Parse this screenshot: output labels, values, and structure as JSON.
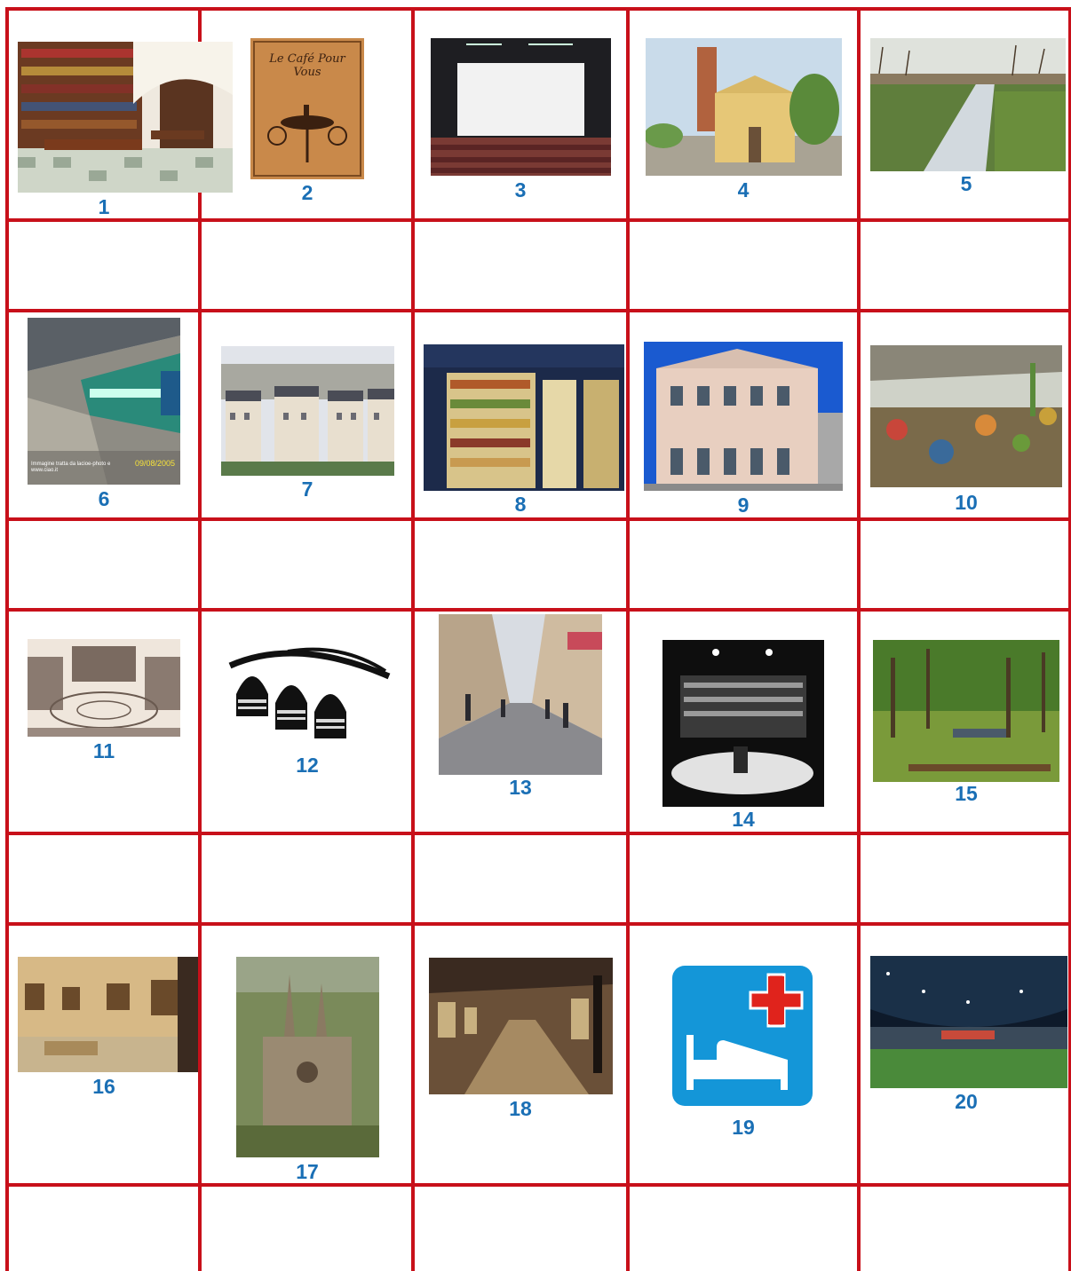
{
  "colors": {
    "grid_line": "#c8101a",
    "number_text": "#1a6fb5",
    "background": "#ffffff"
  },
  "items": [
    {
      "number": "1",
      "picture": "library-reading-room"
    },
    {
      "number": "2",
      "picture": "cafe-poster",
      "poster_text": "Le Café Pour Vous"
    },
    {
      "number": "3",
      "picture": "cinema-screen-room"
    },
    {
      "number": "4",
      "picture": "church-with-bell-tower"
    },
    {
      "number": "5",
      "picture": "canal-in-countryside"
    },
    {
      "number": "6",
      "picture": "train-station-platform",
      "watermark_left": "Immagine tratta da lacioe-photo e www.ciao.it",
      "watermark_date": "09/08/2005"
    },
    {
      "number": "7",
      "picture": "city-rooftops"
    },
    {
      "number": "8",
      "picture": "grocery-shop-front"
    },
    {
      "number": "9",
      "picture": "town-hall-building"
    },
    {
      "number": "10",
      "picture": "covered-market"
    },
    {
      "number": "11",
      "picture": "historic-square-engraving"
    },
    {
      "number": "12",
      "picture": "tunnel-logo"
    },
    {
      "number": "13",
      "picture": "pedestrian-shopping-street"
    },
    {
      "number": "14",
      "picture": "theatre-interior"
    },
    {
      "number": "15",
      "picture": "park-with-trees"
    },
    {
      "number": "16",
      "picture": "museum-gallery"
    },
    {
      "number": "17",
      "picture": "cathedral-aerial"
    },
    {
      "number": "18",
      "picture": "shopping-arcade"
    },
    {
      "number": "19",
      "picture": "hospital-sign-icon"
    },
    {
      "number": "20",
      "picture": "stadium-interior"
    }
  ]
}
